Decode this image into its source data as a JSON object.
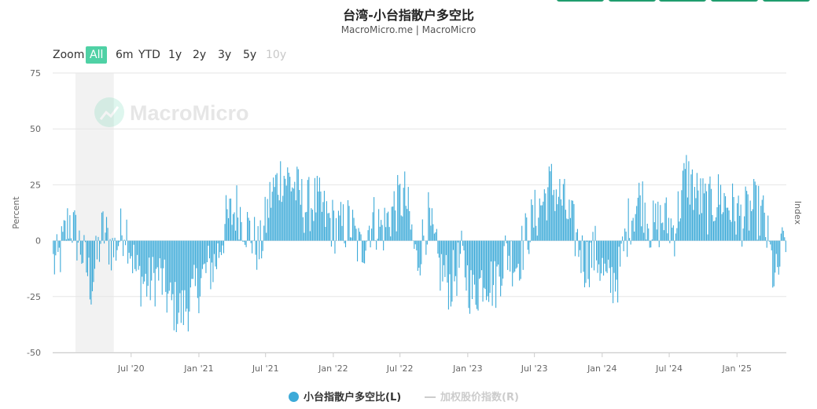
{
  "header": {
    "title": "台湾-小台指散户多空比",
    "subtitle": "MacroMicro.me | MacroMicro"
  },
  "zoom": {
    "label": "Zoom",
    "buttons": [
      "All",
      "6m",
      "YTD",
      "1y",
      "2y",
      "3y",
      "5y",
      "10y"
    ],
    "active": "All",
    "disabled": [
      "10y"
    ]
  },
  "watermark": "MacroMicro",
  "colors": {
    "bar": "#3caad8",
    "accent": "#4fd1a5",
    "shade": "#f2f2f2",
    "index_line": "#cccccc"
  },
  "legend": {
    "series_left": "小台指散户多空比(L)",
    "series_right": "加权股价指数(R)"
  },
  "chart_data": {
    "type": "bar",
    "title": "台湾-小台指散户多空比",
    "ylabel": "Percent",
    "ylabel_right": "Index",
    "ylim": [
      -50,
      75
    ],
    "yticks": [
      75,
      50,
      25,
      0,
      -25,
      -50
    ],
    "x_tick_labels": [
      "Jul '20",
      "Jan '21",
      "Jul '21",
      "Jan '22",
      "Jul '22",
      "Jan '23",
      "Jul '23",
      "Jan '24",
      "Jul '24",
      "Jan '25"
    ],
    "x_tick_dates": [
      "2020-07-01",
      "2021-01-01",
      "2021-07-01",
      "2022-01-01",
      "2022-07-01",
      "2023-01-01",
      "2023-07-01",
      "2024-01-01",
      "2024-07-01",
      "2025-01-01"
    ],
    "x_range": [
      "2019-12-01",
      "2025-05-15"
    ],
    "shaded_period": [
      "2020-02-01",
      "2020-05-15"
    ],
    "grid": true,
    "legend_position": "bottom-center",
    "series": [
      {
        "name": "小台指散户多空比(L)",
        "monthly": [
          {
            "date": "2019-12-15",
            "value": -10
          },
          {
            "date": "2020-01-15",
            "value": 10
          },
          {
            "date": "2020-02-15",
            "value": -3
          },
          {
            "date": "2020-03-15",
            "value": -20
          },
          {
            "date": "2020-04-15",
            "value": 5
          },
          {
            "date": "2020-05-15",
            "value": -5
          },
          {
            "date": "2020-06-15",
            "value": 8
          },
          {
            "date": "2020-07-15",
            "value": -15
          },
          {
            "date": "2020-08-15",
            "value": -20
          },
          {
            "date": "2020-09-15",
            "value": -15
          },
          {
            "date": "2020-10-15",
            "value": -28
          },
          {
            "date": "2020-11-15",
            "value": -32
          },
          {
            "date": "2020-12-15",
            "value": -25
          },
          {
            "date": "2021-01-15",
            "value": -15
          },
          {
            "date": "2021-02-15",
            "value": -10
          },
          {
            "date": "2021-03-15",
            "value": 8
          },
          {
            "date": "2021-04-15",
            "value": 15
          },
          {
            "date": "2021-05-15",
            "value": 5
          },
          {
            "date": "2021-06-15",
            "value": -5
          },
          {
            "date": "2021-07-15",
            "value": 20
          },
          {
            "date": "2021-08-15",
            "value": 30
          },
          {
            "date": "2021-09-15",
            "value": 25
          },
          {
            "date": "2021-10-15",
            "value": 15
          },
          {
            "date": "2021-11-15",
            "value": 18
          },
          {
            "date": "2021-12-15",
            "value": 10
          },
          {
            "date": "2022-01-15",
            "value": 5
          },
          {
            "date": "2022-02-15",
            "value": 8
          },
          {
            "date": "2022-03-15",
            "value": -5
          },
          {
            "date": "2022-04-15",
            "value": 10
          },
          {
            "date": "2022-05-15",
            "value": 5
          },
          {
            "date": "2022-06-15",
            "value": 15
          },
          {
            "date": "2022-07-15",
            "value": 20
          },
          {
            "date": "2022-08-15",
            "value": -10
          },
          {
            "date": "2022-09-15",
            "value": 10
          },
          {
            "date": "2022-10-15",
            "value": -12
          },
          {
            "date": "2022-11-15",
            "value": -20
          },
          {
            "date": "2022-12-15",
            "value": -8
          },
          {
            "date": "2023-01-15",
            "value": -25
          },
          {
            "date": "2023-02-15",
            "value": -15
          },
          {
            "date": "2023-03-15",
            "value": -20
          },
          {
            "date": "2023-04-15",
            "value": -5
          },
          {
            "date": "2023-05-15",
            "value": -10
          },
          {
            "date": "2023-06-15",
            "value": 5
          },
          {
            "date": "2023-07-15",
            "value": 15
          },
          {
            "date": "2023-08-15",
            "value": 25
          },
          {
            "date": "2023-09-15",
            "value": 18
          },
          {
            "date": "2023-10-15",
            "value": 5
          },
          {
            "date": "2023-11-15",
            "value": -10
          },
          {
            "date": "2023-12-15",
            "value": -5
          },
          {
            "date": "2024-01-15",
            "value": -20
          },
          {
            "date": "2024-02-15",
            "value": -15
          },
          {
            "date": "2024-03-15",
            "value": 10
          },
          {
            "date": "2024-04-15",
            "value": 20
          },
          {
            "date": "2024-05-15",
            "value": 5
          },
          {
            "date": "2024-06-15",
            "value": 10
          },
          {
            "date": "2024-07-15",
            "value": 5
          },
          {
            "date": "2024-08-15",
            "value": 30
          },
          {
            "date": "2024-09-15",
            "value": 20
          },
          {
            "date": "2024-10-15",
            "value": 15
          },
          {
            "date": "2024-11-15",
            "value": 20
          },
          {
            "date": "2024-12-15",
            "value": 15
          },
          {
            "date": "2025-01-15",
            "value": 10
          },
          {
            "date": "2025-02-15",
            "value": 15
          },
          {
            "date": "2025-03-15",
            "value": 10
          },
          {
            "date": "2025-04-15",
            "value": -20
          },
          {
            "date": "2025-05-15",
            "value": 5
          }
        ]
      },
      {
        "name": "加权股价指数(R)",
        "hidden": true,
        "values": []
      }
    ]
  }
}
